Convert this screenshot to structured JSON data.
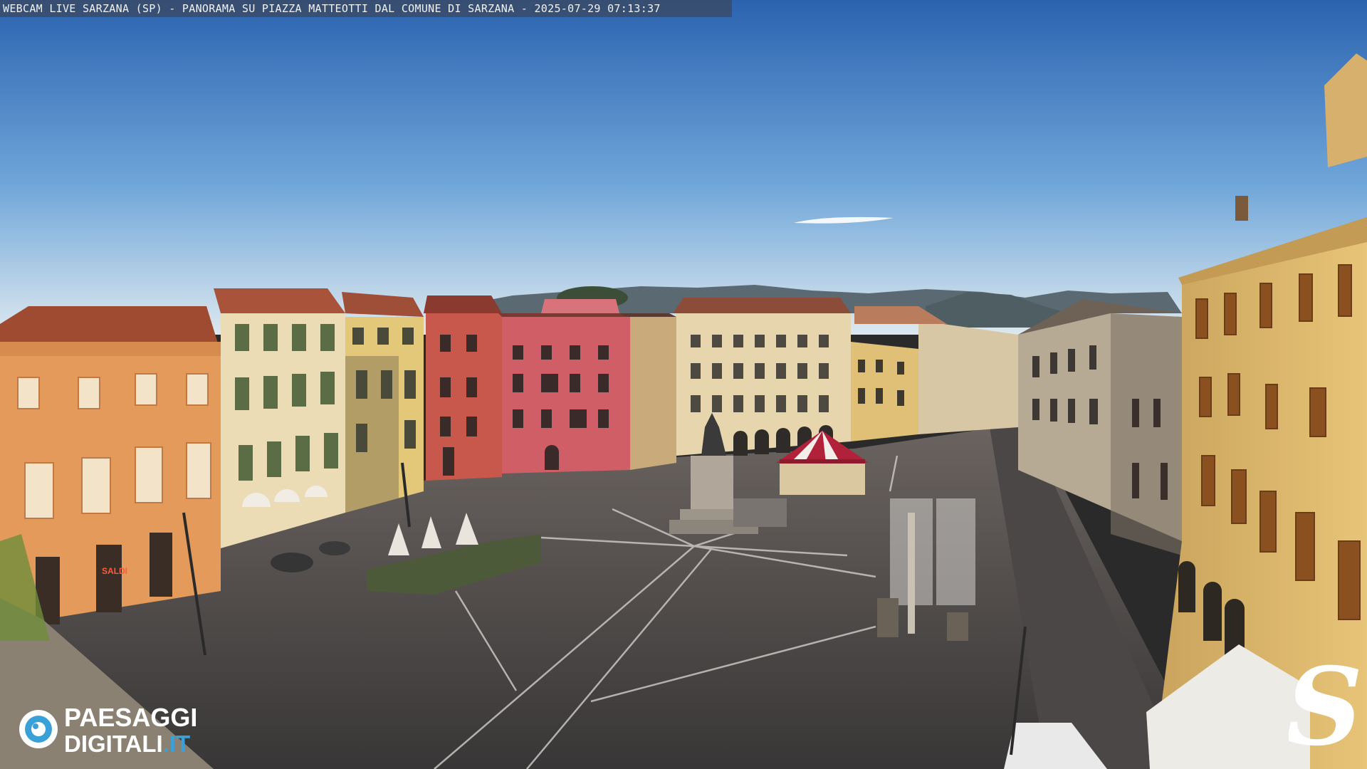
{
  "overlay": {
    "caption": "WEBCAM LIVE SARZANA (SP) - PANORAMA SU PIAZZA MATTEOTTI DAL COMUNE DI SARZANA - 2025-07-29  07:13:37"
  },
  "branding": {
    "left_logo_line1": "PAESAGGI",
    "left_logo_line2": "DIGITALI",
    "left_logo_suffix": ".IT",
    "right_logo_letter": "S"
  },
  "signage": {
    "shop_sign": "SALDI"
  },
  "colors": {
    "sky_top": "#2c66b3",
    "sky_horizon": "#d7e5ef",
    "piazza": "#4a4847",
    "ochre_building": "#e8c27a",
    "orange_building": "#e39a5b",
    "red_building": "#c9584c",
    "pink_building": "#cf5e66",
    "carousel_red": "#b1213a",
    "logo_blue": "#3aa0d8"
  }
}
